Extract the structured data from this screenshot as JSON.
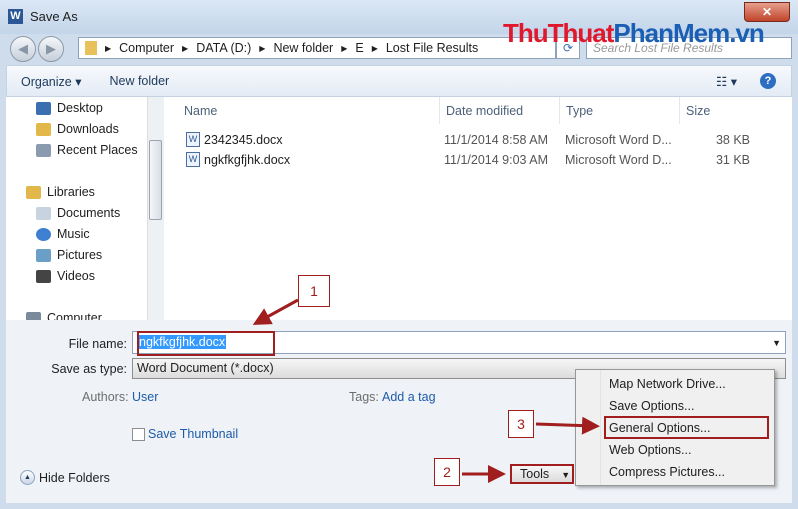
{
  "window": {
    "title": "Save As",
    "close": "✕"
  },
  "address": {
    "crumbs": [
      "Computer",
      "DATA (D:)",
      "New folder",
      "E",
      "Lost File Results"
    ],
    "search_placeholder": "Search Lost File Results"
  },
  "watermark": {
    "part1": "ThuThuat",
    "part2": "PhanMem",
    "part3": ".vn"
  },
  "toolbar": {
    "organize": "Organize ▾",
    "new_folder": "New folder",
    "view": "☷ ▾",
    "help": "?"
  },
  "sidebar": {
    "items": [
      {
        "label": "Desktop",
        "color": "#3a6fb0"
      },
      {
        "label": "Downloads",
        "color": "#e2b84a"
      },
      {
        "label": "Recent Places",
        "color": "#8a9bb0"
      },
      {
        "label": "Libraries",
        "color": "#e2b84a"
      },
      {
        "label": "Documents",
        "color": "#c8d3e0"
      },
      {
        "label": "Music",
        "color": "#3d7fd0"
      },
      {
        "label": "Pictures",
        "color": "#6aa0c8"
      },
      {
        "label": "Videos",
        "color": "#444"
      },
      {
        "label": "Computer",
        "color": "#7a8a9a"
      }
    ]
  },
  "files": {
    "columns": [
      "Name",
      "Date modified",
      "Type",
      "Size"
    ],
    "rows": [
      {
        "name": "2342345.docx",
        "date": "11/1/2014 8:58 AM",
        "type": "Microsoft Word D...",
        "size": "38 KB"
      },
      {
        "name": "ngkfkgfjhk.docx",
        "date": "11/1/2014 9:03 AM",
        "type": "Microsoft Word D...",
        "size": "31 KB"
      }
    ]
  },
  "form": {
    "file_name_label": "File name:",
    "file_name_value": "ngkfkgfjhk.docx",
    "save_type_label": "Save as type:",
    "save_type_value": "Word Document (*.docx)",
    "authors_label": "Authors:",
    "authors_value": "User",
    "tags_label": "Tags:",
    "tags_value": "Add a tag",
    "thumbnail_label": "Save Thumbnail"
  },
  "footer": {
    "hide_folders": "Hide Folders",
    "tools": "Tools"
  },
  "tools_menu": [
    "Map Network Drive...",
    "Save Options...",
    "General Options...",
    "Web Options...",
    "Compress Pictures..."
  ],
  "callouts": [
    "1",
    "2",
    "3"
  ]
}
